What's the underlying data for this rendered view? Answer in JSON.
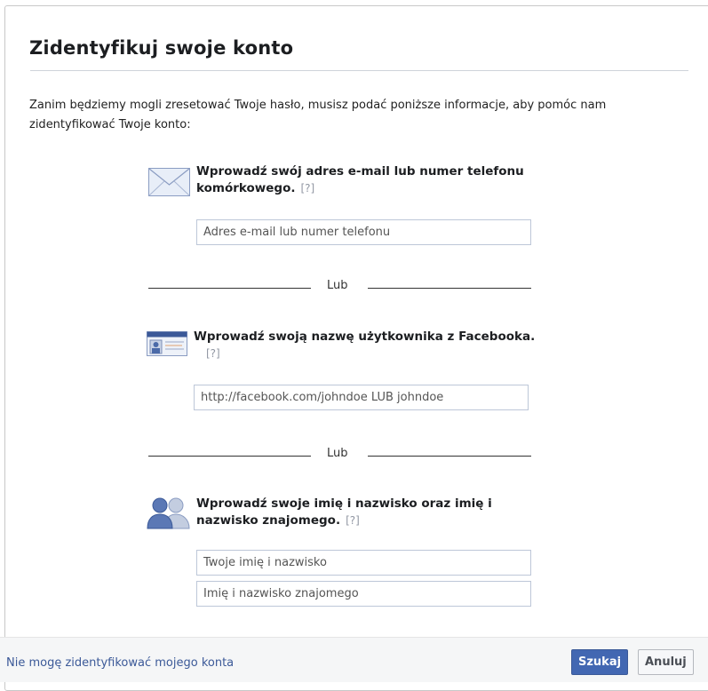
{
  "dialog": {
    "title": "Zidentyfikuj swoje konto",
    "intro": "Zanim będziemy mogli zresetować Twoje hasło, musisz podać poniższe informacje, aby pomóc nam zidentyfikować Twoje konto:"
  },
  "sections": {
    "email": {
      "label_line1": "Wprowadź swój adres e-mail lub numer telefonu",
      "label_line2": "komórkowego.",
      "help": "[?]",
      "placeholder": "Adres e-mail lub numer telefonu",
      "icon": "envelope-icon"
    },
    "username": {
      "label": "Wprowadź swoją nazwę użytkownika z Facebooka.",
      "help": "[?]",
      "placeholder": "http://facebook.com/johndoe LUB johndoe",
      "icon": "id-card-icon"
    },
    "name": {
      "label_line1": "Wprowadź swoje imię i nazwisko oraz imię i",
      "label_line2": "nazwisko znajomego.",
      "help": "[?]",
      "placeholder_own": "Twoje imię i nazwisko",
      "placeholder_friend": "Imię i nazwisko znajomego",
      "icon": "friends-icon"
    }
  },
  "separators": {
    "or_label": "Lub"
  },
  "footer": {
    "link": "Nie mogę zidentyfikować mojego konta",
    "search_button": "Szukaj",
    "cancel_button": "Anuluj"
  },
  "colors": {
    "brand": "#3b5998",
    "primary_button": "#4267b2",
    "link": "#3b5998"
  }
}
